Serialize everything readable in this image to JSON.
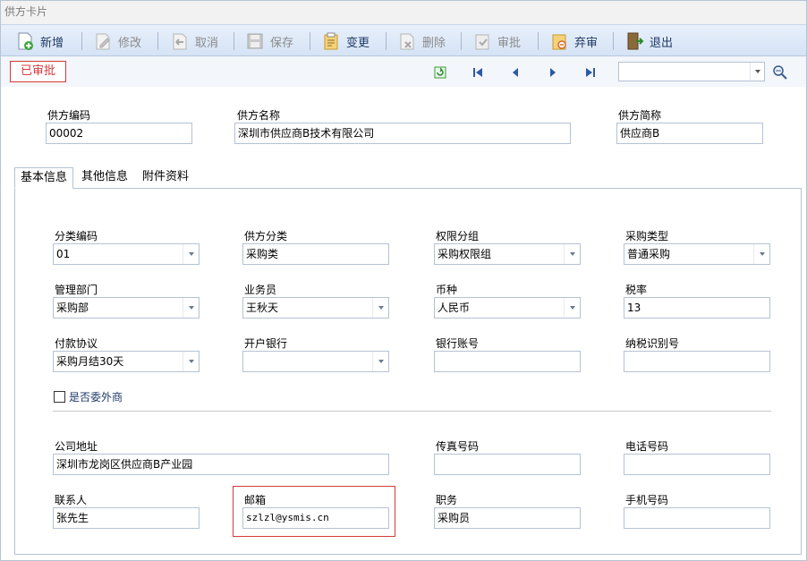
{
  "window": {
    "title": "供方卡片"
  },
  "toolbar": {
    "new": "新增",
    "edit": "修改",
    "cancel": "取消",
    "save": "保存",
    "change": "变更",
    "delete": "删除",
    "approve": "审批",
    "unapprove": "弃审",
    "exit": "退出"
  },
  "status": {
    "badge": "已审批"
  },
  "nav": {
    "search_value": ""
  },
  "header": {
    "code_label": "供方编码",
    "code_value": "00002",
    "name_label": "供方名称",
    "name_value": "深圳市供应商B技术有限公司",
    "short_label": "供方简称",
    "short_value": "供应商B"
  },
  "tabs": [
    "基本信息",
    "其他信息",
    "附件资料"
  ],
  "basic": {
    "category_code_label": "分类编码",
    "category_code_value": "01",
    "category_label": "供方分类",
    "category_value": "采购类",
    "permission_label": "权限分组",
    "permission_value": "采购权限组",
    "purchase_type_label": "采购类型",
    "purchase_type_value": "普通采购",
    "dept_label": "管理部门",
    "dept_value": "采购部",
    "staff_label": "业务员",
    "staff_value": "王秋天",
    "currency_label": "币种",
    "currency_value": "人民币",
    "tax_label": "税率",
    "tax_value": "13",
    "payment_label": "付款协议",
    "payment_value": "采购月结30天",
    "bank_label": "开户银行",
    "bank_value": "",
    "account_label": "银行账号",
    "account_value": "",
    "taxid_label": "纳税识别号",
    "taxid_value": "",
    "outsource_label": "是否委外商",
    "address_label": "公司地址",
    "address_value": "深圳市龙岗区供应商B产业园",
    "fax_label": "传真号码",
    "fax_value": "",
    "phone_label": "电话号码",
    "phone_value": "",
    "contact_label": "联系人",
    "contact_value": "张先生",
    "email_label": "邮箱",
    "email_value": "szlzl@ysmis.cn",
    "position_label": "职务",
    "position_value": "采购员",
    "mobile_label": "手机号码",
    "mobile_value": ""
  },
  "colors": {
    "accent": "#d43a3a",
    "toolbar_text": "#1f3a66",
    "disabled_text": "#8a8a8a"
  }
}
